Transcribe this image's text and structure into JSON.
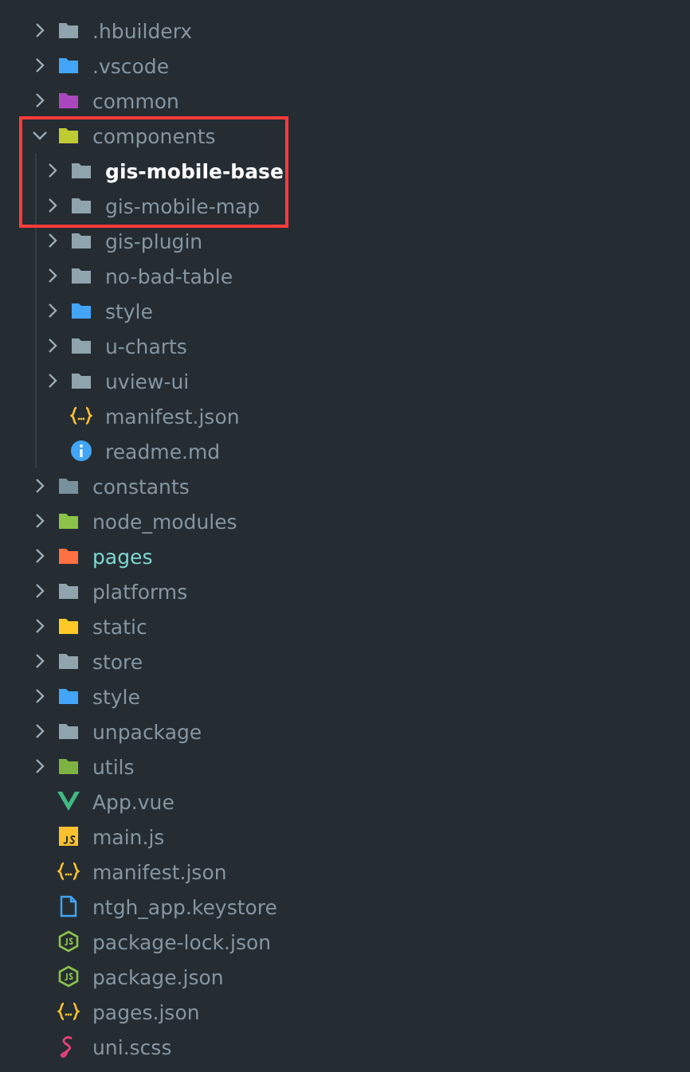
{
  "tree": [
    {
      "name": ".hbuilderx",
      "kind": "folder",
      "color": "#90a4ae",
      "expanded": false
    },
    {
      "name": ".vscode",
      "kind": "folder",
      "color": "#42a5f5",
      "expanded": false
    },
    {
      "name": "common",
      "kind": "folder",
      "color": "#ab47bc",
      "expanded": false
    },
    {
      "name": "components",
      "kind": "folder",
      "color": "#c0ca33",
      "expanded": true,
      "highlighted": true,
      "children": [
        {
          "name": "gis-mobile-base",
          "kind": "folder",
          "color": "#90a4ae",
          "expanded": false,
          "selected": true,
          "highlighted": true
        },
        {
          "name": "gis-mobile-map",
          "kind": "folder",
          "color": "#90a4ae",
          "expanded": false,
          "highlighted": true
        },
        {
          "name": "gis-plugin",
          "kind": "folder",
          "color": "#90a4ae",
          "expanded": false
        },
        {
          "name": "no-bad-table",
          "kind": "folder",
          "color": "#90a4ae",
          "expanded": false
        },
        {
          "name": "style",
          "kind": "folder",
          "color": "#42a5f5",
          "expanded": false
        },
        {
          "name": "u-charts",
          "kind": "folder",
          "color": "#90a4ae",
          "expanded": false
        },
        {
          "name": "uview-ui",
          "kind": "folder",
          "color": "#90a4ae",
          "expanded": false
        },
        {
          "name": "manifest.json",
          "kind": "json"
        },
        {
          "name": "readme.md",
          "kind": "info"
        }
      ]
    },
    {
      "name": "constants",
      "kind": "folder",
      "color": "#78909c",
      "expanded": false
    },
    {
      "name": "node_modules",
      "kind": "folder",
      "color": "#8bc34a",
      "expanded": false
    },
    {
      "name": "pages",
      "kind": "folder",
      "color": "#ff7043",
      "expanded": false,
      "modified": true
    },
    {
      "name": "platforms",
      "kind": "folder",
      "color": "#90a4ae",
      "expanded": false
    },
    {
      "name": "static",
      "kind": "folder",
      "color": "#ffca28",
      "expanded": false
    },
    {
      "name": "store",
      "kind": "folder",
      "color": "#90a4ae",
      "expanded": false
    },
    {
      "name": "style",
      "kind": "folder",
      "color": "#42a5f5",
      "expanded": false
    },
    {
      "name": "unpackage",
      "kind": "folder",
      "color": "#90a4ae",
      "expanded": false
    },
    {
      "name": "utils",
      "kind": "folder",
      "color": "#7cb342",
      "expanded": false
    },
    {
      "name": "App.vue",
      "kind": "vue"
    },
    {
      "name": "main.js",
      "kind": "js"
    },
    {
      "name": "manifest.json",
      "kind": "json"
    },
    {
      "name": "ntgh_app.keystore",
      "kind": "doc"
    },
    {
      "name": "package-lock.json",
      "kind": "node"
    },
    {
      "name": "package.json",
      "kind": "node"
    },
    {
      "name": "pages.json",
      "kind": "json"
    },
    {
      "name": "uni.scss",
      "kind": "sass"
    }
  ],
  "annotation": {
    "color": "#ff3b3b"
  }
}
